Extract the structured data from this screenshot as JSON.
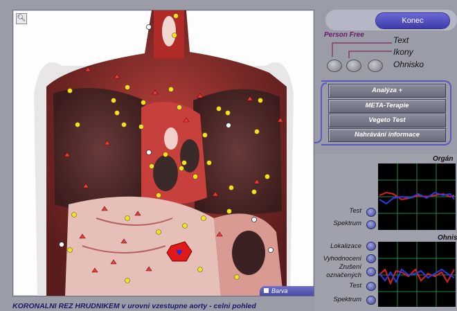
{
  "image_panel": {
    "zoom_icon": "magnifier-icon",
    "color_toggle_label": "Barva",
    "caption": "KORONALNI REZ HRUDNIKEM v urovni vzestupne aorty - celni pohled"
  },
  "header": {
    "exit_label": "Konec"
  },
  "mode": {
    "title": "Person Free",
    "options": [
      "Text",
      "Ikony",
      "Ohnisko"
    ]
  },
  "menu": {
    "items": [
      "Analýza +",
      "META-Terapie",
      "Vegeto Test",
      "Nahrávání informace"
    ]
  },
  "organ_panel": {
    "title": "Orgán",
    "controls": [
      "Test",
      "Spektrum"
    ]
  },
  "focus_panel": {
    "title": "Ohnis",
    "controls": [
      "Lokalizace",
      "Vyhodnocení",
      "Zrušení označených",
      "Test",
      "Spektrum"
    ]
  },
  "colors": {
    "accent": "#4a48b8",
    "series_red": "#e02020",
    "series_blue": "#2a3ae8",
    "grid": "#1f8a3a"
  }
}
